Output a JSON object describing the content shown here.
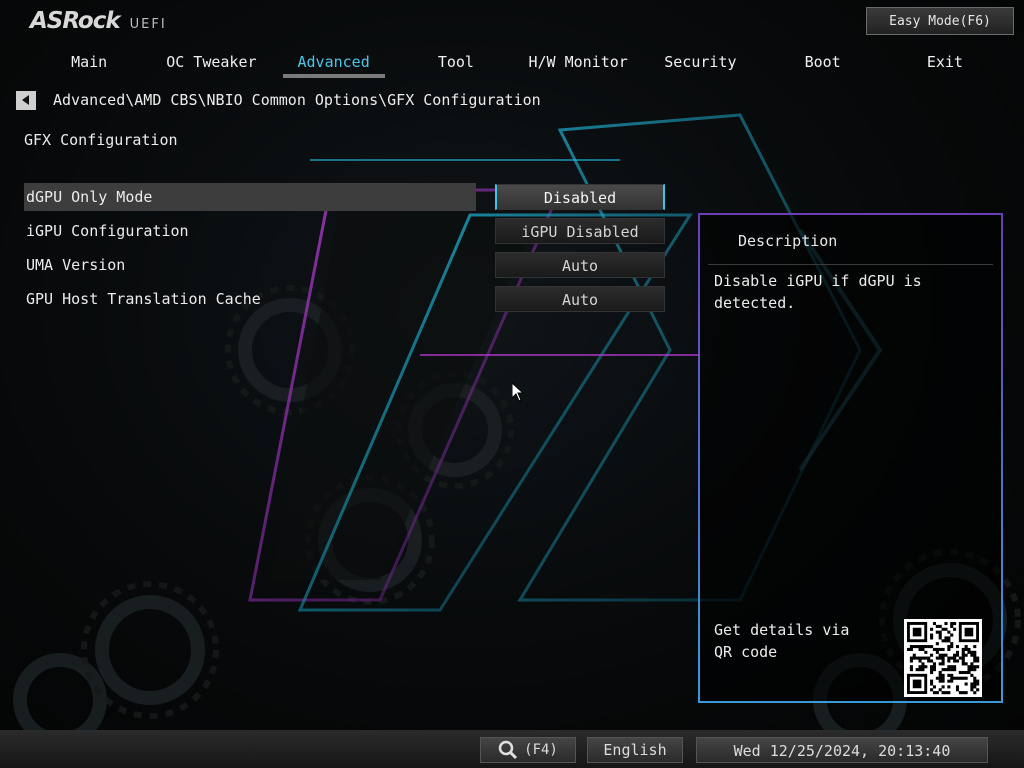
{
  "header": {
    "brand": "ASRock",
    "brand_sub": "UEFI",
    "easy_mode_label": "Easy Mode(F6)"
  },
  "tabs": [
    {
      "label": "Main",
      "active": false
    },
    {
      "label": "OC Tweaker",
      "active": false
    },
    {
      "label": "Advanced",
      "active": true
    },
    {
      "label": "Tool",
      "active": false
    },
    {
      "label": "H/W Monitor",
      "active": false
    },
    {
      "label": "Security",
      "active": false
    },
    {
      "label": "Boot",
      "active": false
    },
    {
      "label": "Exit",
      "active": false
    }
  ],
  "breadcrumb": "Advanced\\AMD CBS\\NBIO Common Options\\GFX Configuration",
  "section_title": "GFX Configuration",
  "settings": [
    {
      "label": "dGPU Only Mode",
      "value": "Disabled",
      "selected": true
    },
    {
      "label": "iGPU Configuration",
      "value": "iGPU Disabled",
      "selected": false
    },
    {
      "label": "UMA Version",
      "value": "Auto",
      "selected": false
    },
    {
      "label": "GPU Host Translation Cache",
      "value": "Auto",
      "selected": false
    }
  ],
  "description": {
    "heading": "Description",
    "text": "Disable iGPU if dGPU is detected.",
    "qr_text": "Get details via QR code"
  },
  "footer": {
    "search_label": "(F4)",
    "language": "English",
    "datetime": "Wed 12/25/2024, 20:13:40"
  },
  "colors": {
    "accent": "#4cc6e8",
    "panel_border_top": "#6a3fb8",
    "panel_border_bottom": "#3a9ad8"
  },
  "icons": {
    "back": "triangle-left-icon",
    "search": "magnifier-icon",
    "qr": "qr-code-icon",
    "cursor": "mouse-pointer-icon"
  }
}
